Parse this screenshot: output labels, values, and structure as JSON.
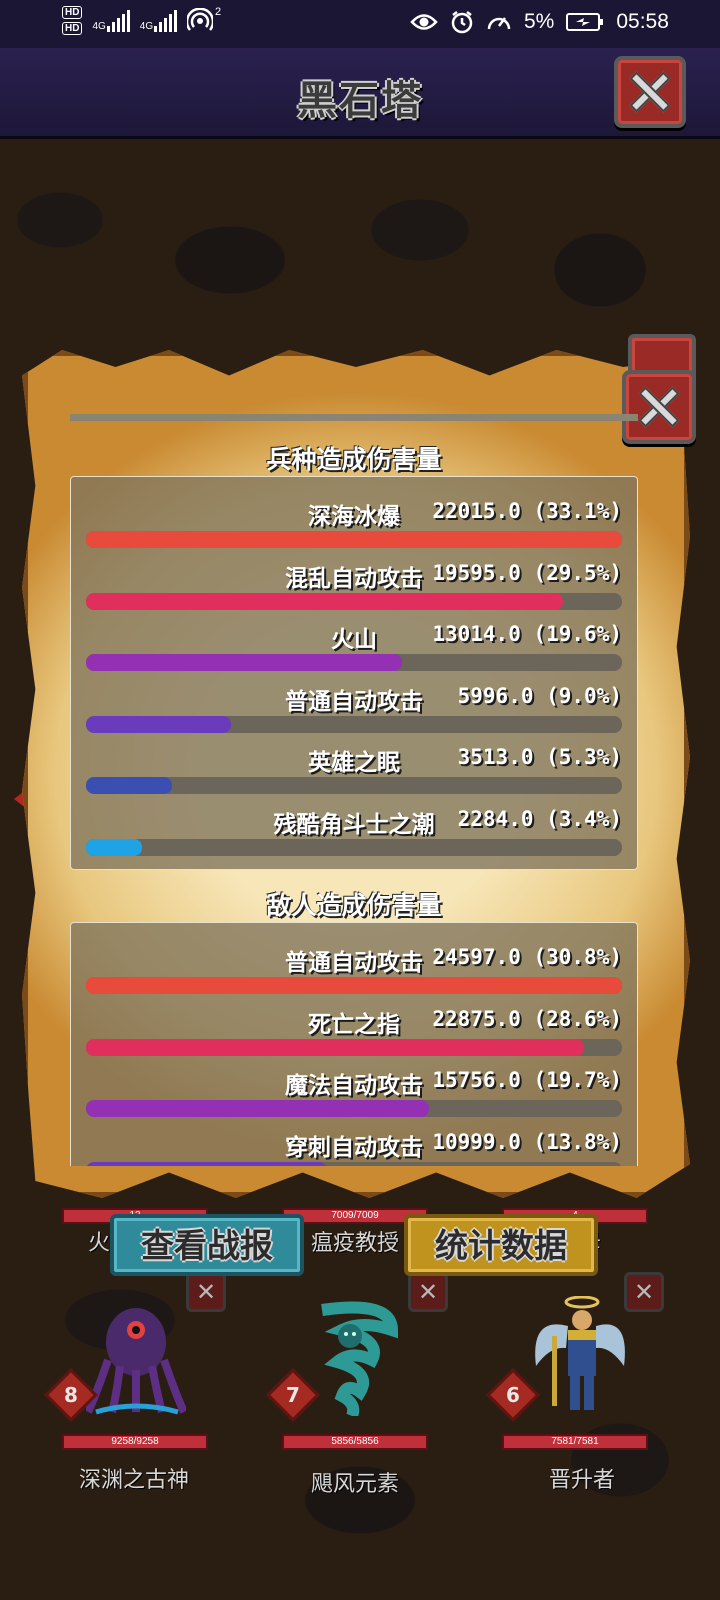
{
  "status_bar": {
    "sim1": "HD",
    "sim2": "HD",
    "net1": "4G",
    "net2": "4G",
    "hotspot_count": "2",
    "battery": "5%",
    "time": "05:58"
  },
  "header": {
    "title": "黑石塔"
  },
  "unit_damage": {
    "title": "兵种造成伤害量",
    "items": [
      {
        "name": "深海冰爆",
        "value": "22015.0 (33.1%)",
        "fraction": 1.0,
        "color": "#e84a3c"
      },
      {
        "name": "混乱自动攻击",
        "value": "19595.0 (29.5%)",
        "fraction": 0.89,
        "color": "#e02f5c"
      },
      {
        "name": "火山",
        "value": "13014.0 (19.6%)",
        "fraction": 0.59,
        "color": "#9430b4"
      },
      {
        "name": "普通自动攻击",
        "value": "5996.0 (9.0%)",
        "fraction": 0.27,
        "color": "#6a3bbd"
      },
      {
        "name": "英雄之眠",
        "value": "3513.0 (5.3%)",
        "fraction": 0.16,
        "color": "#3b4fb3"
      },
      {
        "name": "残酷角斗士之潮",
        "value": "2284.0 (3.4%)",
        "fraction": 0.105,
        "color": "#1ea4e6"
      }
    ]
  },
  "enemy_damage": {
    "title": "敌人造成伤害量",
    "items": [
      {
        "name": "普通自动攻击",
        "value": "24597.0 (30.8%)",
        "fraction": 1.0,
        "color": "#e84a3c"
      },
      {
        "name": "死亡之指",
        "value": "22875.0 (28.6%)",
        "fraction": 0.93,
        "color": "#e02f5c"
      },
      {
        "name": "魔法自动攻击",
        "value": "15756.0 (19.7%)",
        "fraction": 0.64,
        "color": "#9430b4"
      },
      {
        "name": "穿刺自动攻击",
        "value": "10999.0 (13.8%)",
        "fraction": 0.45,
        "color": "#6a3bbd"
      }
    ]
  },
  "buttons": {
    "battle_report": "查看战报",
    "statistics": "统计数据"
  },
  "team_top": [
    {
      "name_fragment": "火",
      "hp": "13"
    },
    {
      "name": "瘟疫教授",
      "hp": "7009/7009"
    },
    {
      "name_fragment": "母",
      "hp": "4"
    }
  ],
  "team_bottom": [
    {
      "name": "深渊之古神",
      "level": "8",
      "hp": "9258/9258"
    },
    {
      "name": "飓风元素",
      "level": "7",
      "hp": "5856/5856"
    },
    {
      "name": "晋升者",
      "level": "6",
      "hp": "7581/7581"
    }
  ],
  "icons": {
    "close": "close-icon",
    "eye": "eye-icon",
    "alarm": "alarm-icon",
    "speed": "speedometer-icon",
    "battery": "battery-icon",
    "hotspot": "hotspot-icon"
  }
}
